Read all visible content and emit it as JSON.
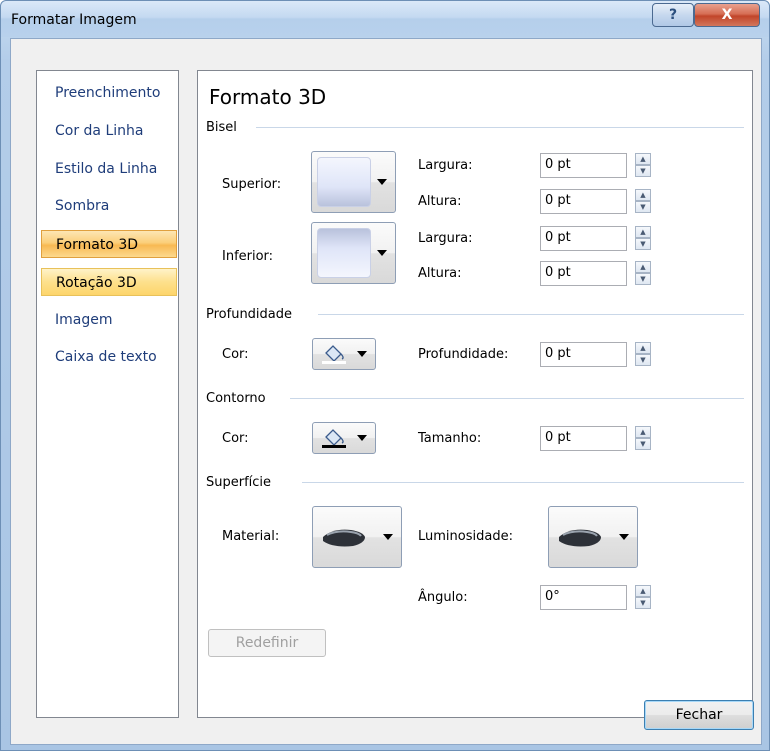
{
  "window": {
    "title": "Formatar Imagem",
    "help_label": "?",
    "close_label": "X"
  },
  "nav": {
    "items": [
      {
        "label": "Preenchimento"
      },
      {
        "label": "Cor da Linha"
      },
      {
        "label": "Estilo da Linha"
      },
      {
        "label": "Sombra"
      },
      {
        "label": "Formato 3D"
      },
      {
        "label": "Rotação 3D"
      },
      {
        "label": "Imagem"
      },
      {
        "label": "Caixa de texto"
      }
    ],
    "selected": "Formato 3D"
  },
  "panel": {
    "heading": "Formato 3D",
    "bevel": {
      "section": "Bisel",
      "top_label": "Superior:",
      "bottom_label": "Inferior:",
      "top_width_label": "Largura:",
      "top_width_value": "0 pt",
      "top_height_label": "Altura:",
      "top_height_value": "0 pt",
      "bottom_width_label": "Largura:",
      "bottom_width_value": "0 pt",
      "bottom_height_label": "Altura:",
      "bottom_height_value": "0 pt"
    },
    "depth": {
      "section": "Profundidade",
      "color_label": "Cor:",
      "depth_label": "Profundidade:",
      "depth_value": "0 pt"
    },
    "contour": {
      "section": "Contorno",
      "color_label": "Cor:",
      "size_label": "Tamanho:",
      "size_value": "0 pt"
    },
    "surface": {
      "section": "Superfície",
      "material_label": "Material:",
      "lighting_label": "Luminosidade:",
      "angle_label": "Ângulo:",
      "angle_value": "0°"
    },
    "reset_label": "Redefinir"
  },
  "footer": {
    "close_label": "Fechar"
  },
  "colors": {
    "accent": "#fbcf7a",
    "link": "#1f3d7a"
  }
}
